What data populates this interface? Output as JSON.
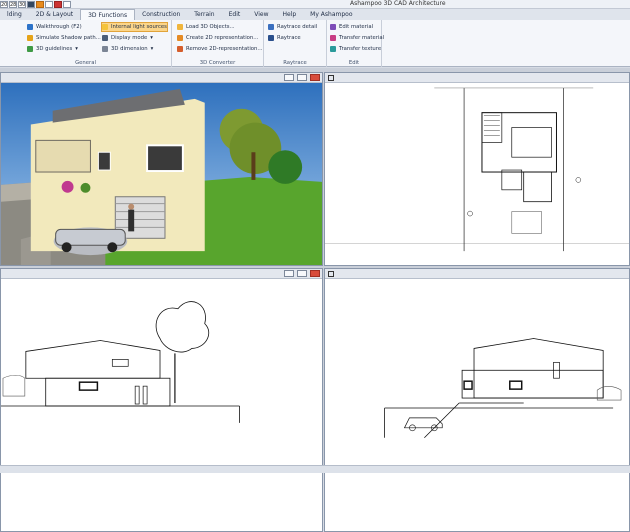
{
  "app": {
    "title": "Ashampoo 3D CAD Architecture"
  },
  "quick_access": {
    "values": [
      "20",
      "28",
      "30"
    ]
  },
  "tabs": [
    {
      "label": "lding"
    },
    {
      "label": "2D & Layout"
    },
    {
      "label": "3D Functions"
    },
    {
      "label": "Construction"
    },
    {
      "label": "Terrain"
    },
    {
      "label": "Edit"
    },
    {
      "label": "View"
    },
    {
      "label": "Help"
    },
    {
      "label": "My Ashampoo"
    }
  ],
  "ribbon": {
    "general": {
      "label": "General",
      "walkthrough": "Walkthrough (F2)",
      "simulate_shadow": "Simulate Shadow path...",
      "guidelines": "3D guidelines",
      "internal_light": "Internal light sources",
      "display_mode": "Display mode",
      "dimension": "3D dimension"
    },
    "converter": {
      "label": "3D Converter",
      "load_objects": "Load 3D Objects...",
      "create_2d": "Create 2D representation...",
      "remove_2d": "Remove 2D-representation..."
    },
    "raytrace": {
      "label": "Raytrace",
      "raytrace_detail": "Raytrace detail",
      "raytrace": "Raytrace"
    },
    "edit": {
      "label": "Edit",
      "edit_material": "Edit material",
      "transfer_material": "Transfer material",
      "transfer_texture": "Transfer texture"
    }
  },
  "icons": {
    "walkthrough": "walk-icon",
    "shadow": "sun-shadow-icon",
    "guidelines": "guideline-icon",
    "light": "light-bulb-icon",
    "display": "display-icon",
    "dimension": "dimension-icon",
    "load": "load-object-icon",
    "create": "create-2d-icon",
    "remove": "remove-2d-icon",
    "raytrace": "raytrace-icon",
    "material": "material-icon"
  },
  "colors": {
    "ribbon_bg": "#f4f6fa",
    "active_tab": "#f7f9fc",
    "highlight": "#fbd58a",
    "sky": "#4f8fd6",
    "grass": "#58a52d",
    "house": "#f2e9bc",
    "close_button": "#d84c3c"
  },
  "status": {
    "text": ""
  }
}
